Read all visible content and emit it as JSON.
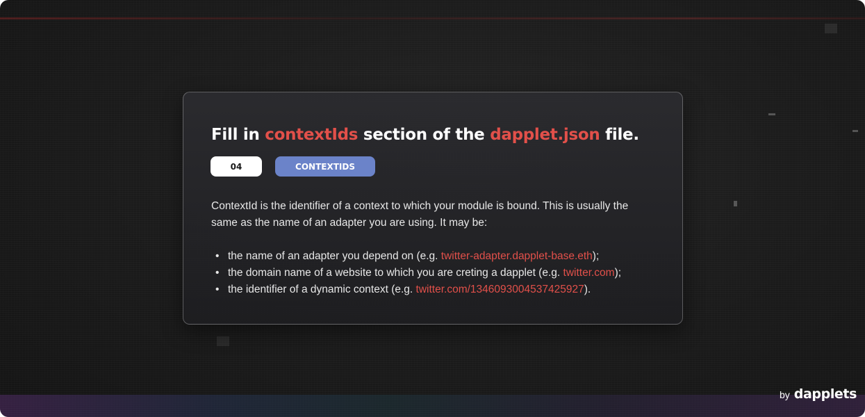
{
  "card": {
    "title": {
      "part1": "Fill in ",
      "highlight1": "contextIds",
      "part2": " section of the ",
      "highlight2": "dapplet.json",
      "part3": " file."
    },
    "step_number": "04",
    "tag_label": "CONTEXTIDS",
    "paragraph": "ContextId is the identifier of a context to which your module is bound. This is usually the same as the name of an adapter you are using. It may be:",
    "bullet_char": "•",
    "items": [
      {
        "before": "the name of an adapter you depend on (e.g. ",
        "link": "twitter-adapter.dapplet-base.eth",
        "after": ");"
      },
      {
        "before": "the domain name of a website to which you are creting a dapplet (e.g. ",
        "link": "twitter.com",
        "after": ");"
      },
      {
        "before": "the identifier of a dynamic context (e.g. ",
        "link": "twitter.com/1346093004537425927",
        "after": ")."
      }
    ]
  },
  "brand": {
    "by": "by",
    "name": "dapplets"
  },
  "colors": {
    "accent": "#e2504a",
    "tag": "#6b83c9",
    "background": "#1c1c1c"
  }
}
